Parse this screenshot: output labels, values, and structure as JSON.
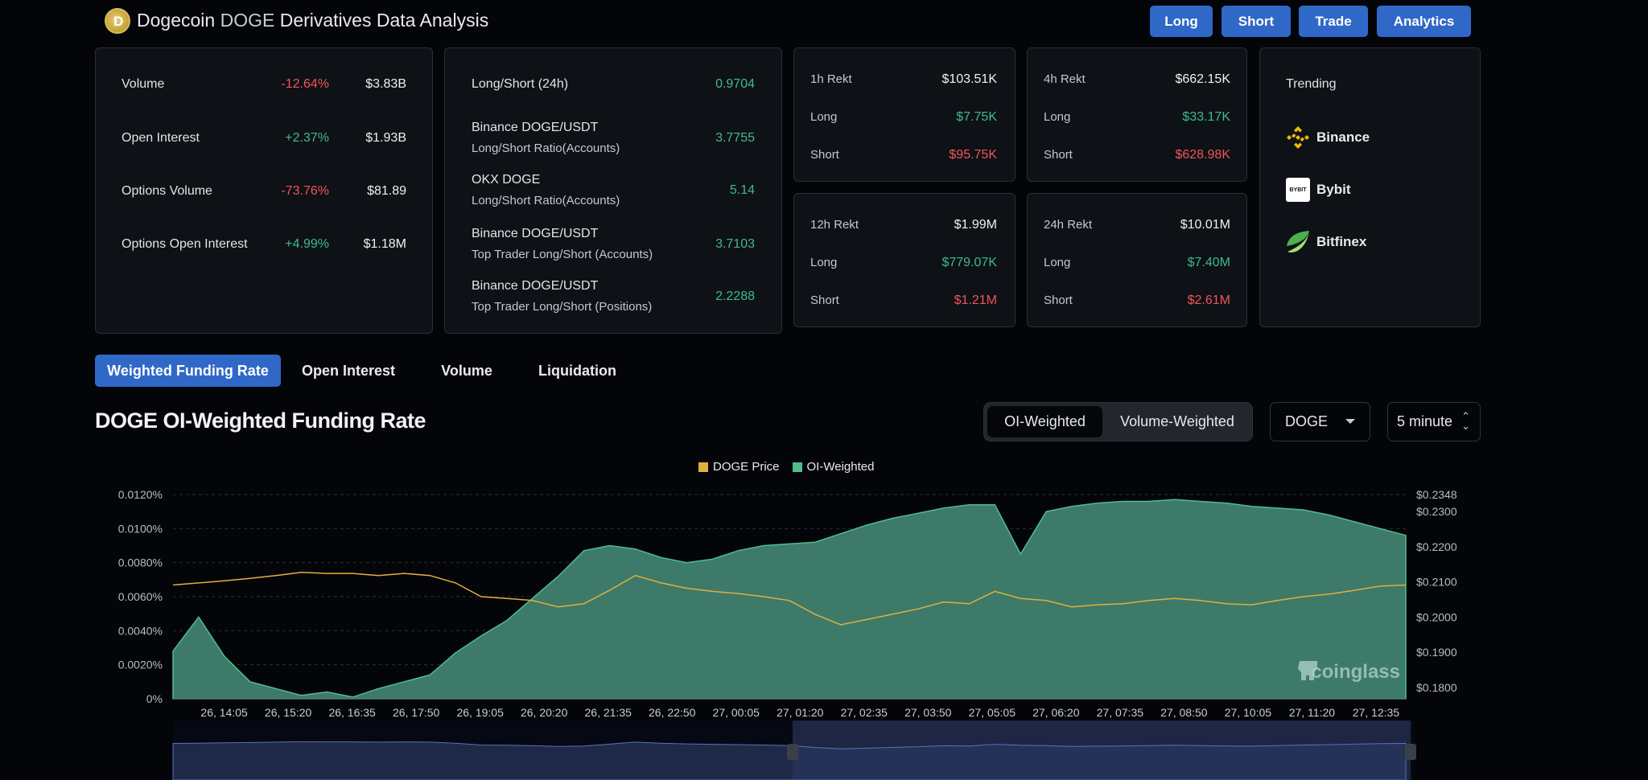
{
  "header": {
    "title_part1": "Dogecoin",
    "title_part2": "DOGE",
    "title_part3": "Derivatives Data Analysis",
    "logo": "dogecoin-logo",
    "buttons": {
      "long": "Long",
      "short": "Short",
      "trade": "Trade",
      "analytics": "Analytics"
    }
  },
  "overview": {
    "rows": [
      {
        "label": "Volume",
        "change": "-12.64%",
        "value": "$3.83B"
      },
      {
        "label": "Open Interest",
        "change": "+2.37%",
        "value": "$1.93B"
      },
      {
        "label": "Options Volume",
        "change": "-73.76%",
        "value": "$81.89"
      },
      {
        "label": "Options Open Interest",
        "change": "+4.99%",
        "value": "$1.18M"
      }
    ]
  },
  "ratios": {
    "rows": [
      {
        "label": "Long/Short (24h)",
        "sub": "",
        "value": "0.9704"
      },
      {
        "label": "Binance DOGE/USDT",
        "sub": "Long/Short Ratio(Accounts)",
        "value": "3.7755"
      },
      {
        "label": "OKX DOGE",
        "sub": "Long/Short Ratio(Accounts)",
        "value": "5.14"
      },
      {
        "label": "Binance DOGE/USDT",
        "sub": "Top Trader Long/Short (Accounts)",
        "value": "3.7103"
      },
      {
        "label": "Binance DOGE/USDT",
        "sub": "Top Trader Long/Short (Positions)",
        "value": "2.2288"
      }
    ]
  },
  "rekt": [
    {
      "label": "1h Rekt",
      "total": "$103.51K",
      "long_label": "Long",
      "long": "$7.75K",
      "short_label": "Short",
      "short": "$95.75K"
    },
    {
      "label": "4h Rekt",
      "total": "$662.15K",
      "long_label": "Long",
      "long": "$33.17K",
      "short_label": "Short",
      "short": "$628.98K"
    },
    {
      "label": "12h Rekt",
      "total": "$1.99M",
      "long_label": "Long",
      "long": "$779.07K",
      "short_label": "Short",
      "short": "$1.21M"
    },
    {
      "label": "24h Rekt",
      "total": "$10.01M",
      "long_label": "Long",
      "long": "$7.40M",
      "short_label": "Short",
      "short": "$2.61M"
    }
  ],
  "trending": {
    "title": "Trending",
    "items": [
      {
        "name": "Binance",
        "icon": "binance-icon"
      },
      {
        "name": "Bybit",
        "icon": "bybit-icon",
        "icon_text": "BYBIT"
      },
      {
        "name": "Bitfinex",
        "icon": "bitfinex-icon"
      }
    ]
  },
  "tabs": [
    "Weighted Funding Rate",
    "Open Interest",
    "Volume",
    "Liquidation"
  ],
  "section_title": "DOGE OI-Weighted Funding Rate",
  "controls": {
    "segments": [
      "OI-Weighted",
      "Volume-Weighted"
    ],
    "active_segment": "OI-Weighted",
    "coin": "DOGE",
    "interval": "5 minute"
  },
  "colors": {
    "accent": "#3068c8",
    "positive": "#3dbb8f",
    "negative": "#f0555a",
    "price_line": "#e0b040",
    "area": "#3d7a69"
  },
  "chart_data": {
    "type": "area",
    "watermark": "coinglass",
    "legend": [
      {
        "name": "DOGE Price",
        "color": "#e0b040"
      },
      {
        "name": "OI-Weighted",
        "color": "#4fbf8a"
      }
    ],
    "legend_position": "top-center",
    "grid": true,
    "x": [
      "26, 13:05",
      "26, 13:35",
      "26, 14:05",
      "26, 14:35",
      "26, 15:05",
      "26, 15:35",
      "26, 16:05",
      "26, 16:35",
      "26, 17:05",
      "26, 17:35",
      "26, 18:05",
      "26, 18:35",
      "26, 19:05",
      "26, 19:35",
      "26, 20:05",
      "26, 20:35",
      "26, 21:05",
      "26, 21:35",
      "26, 22:05",
      "26, 22:35",
      "26, 23:05",
      "26, 23:35",
      "27, 00:05",
      "27, 00:35",
      "27, 01:05",
      "27, 01:35",
      "27, 02:05",
      "27, 02:35",
      "27, 03:05",
      "27, 03:35",
      "27, 04:05",
      "27, 04:35",
      "27, 05:05",
      "27, 05:35",
      "27, 06:05",
      "27, 06:35",
      "27, 07:05",
      "27, 07:35",
      "27, 08:05",
      "27, 08:35",
      "27, 09:05",
      "27, 09:35",
      "27, 10:05",
      "27, 10:35",
      "27, 11:05",
      "27, 11:35",
      "27, 12:05",
      "27, 12:35",
      "27, 13:05"
    ],
    "x_ticks": [
      "26, 14:05",
      "26, 15:20",
      "26, 16:35",
      "26, 17:50",
      "26, 19:05",
      "26, 20:20",
      "26, 21:35",
      "26, 22:50",
      "27, 00:05",
      "27, 01:20",
      "27, 02:35",
      "27, 03:50",
      "27, 05:05",
      "27, 06:20",
      "27, 07:35",
      "27, 08:50",
      "27, 10:05",
      "27, 11:20",
      "27, 12:35"
    ],
    "y_left": {
      "ticks": [
        "0%",
        "0.0020%",
        "0.0040%",
        "0.0060%",
        "0.0080%",
        "0.0100%",
        "0.0120%"
      ],
      "range": [
        0,
        0.012
      ]
    },
    "y_right": {
      "ticks": [
        "$0.1800",
        "$0.1900",
        "$0.2000",
        "$0.2100",
        "$0.2200",
        "$0.2300",
        "$0.2348"
      ],
      "values": [
        0.18,
        0.19,
        0.2,
        0.21,
        0.22,
        0.23,
        0.2348
      ]
    },
    "series": [
      {
        "name": "OI-Weighted",
        "axis": "left",
        "values": [
          0.0028,
          0.0048,
          0.0025,
          0.001,
          0.0006,
          0.0002,
          0.0004,
          0.0001,
          0.0006,
          0.001,
          0.0014,
          0.0027,
          0.0037,
          0.0046,
          0.0059,
          0.0072,
          0.0087,
          0.009,
          0.0088,
          0.0083,
          0.008,
          0.0082,
          0.0087,
          0.009,
          0.0091,
          0.0092,
          0.0097,
          0.0102,
          0.0106,
          0.0109,
          0.0112,
          0.0114,
          0.0114,
          0.0085,
          0.011,
          0.0113,
          0.0115,
          0.0116,
          0.0116,
          0.0117,
          0.0116,
          0.0115,
          0.0113,
          0.0112,
          0.0111,
          0.0108,
          0.0104,
          0.01,
          0.0096
        ]
      },
      {
        "name": "DOGE Price",
        "axis": "right",
        "values": [
          0.2091,
          0.2097,
          0.2103,
          0.211,
          0.2118,
          0.2127,
          0.2124,
          0.2124,
          0.2118,
          0.2124,
          0.2118,
          0.2097,
          0.2058,
          0.2053,
          0.2047,
          0.2029,
          0.2038,
          0.2076,
          0.2118,
          0.2097,
          0.2082,
          0.2073,
          0.2067,
          0.2058,
          0.2047,
          0.2008,
          0.1978,
          0.1993,
          0.2008,
          0.2023,
          0.2043,
          0.2038,
          0.2073,
          0.2053,
          0.2047,
          0.2029,
          0.2035,
          0.2038,
          0.2047,
          0.2053,
          0.2047,
          0.2038,
          0.2035,
          0.2047,
          0.2058,
          0.2065,
          0.2076,
          0.2088,
          0.2091
        ]
      }
    ]
  }
}
